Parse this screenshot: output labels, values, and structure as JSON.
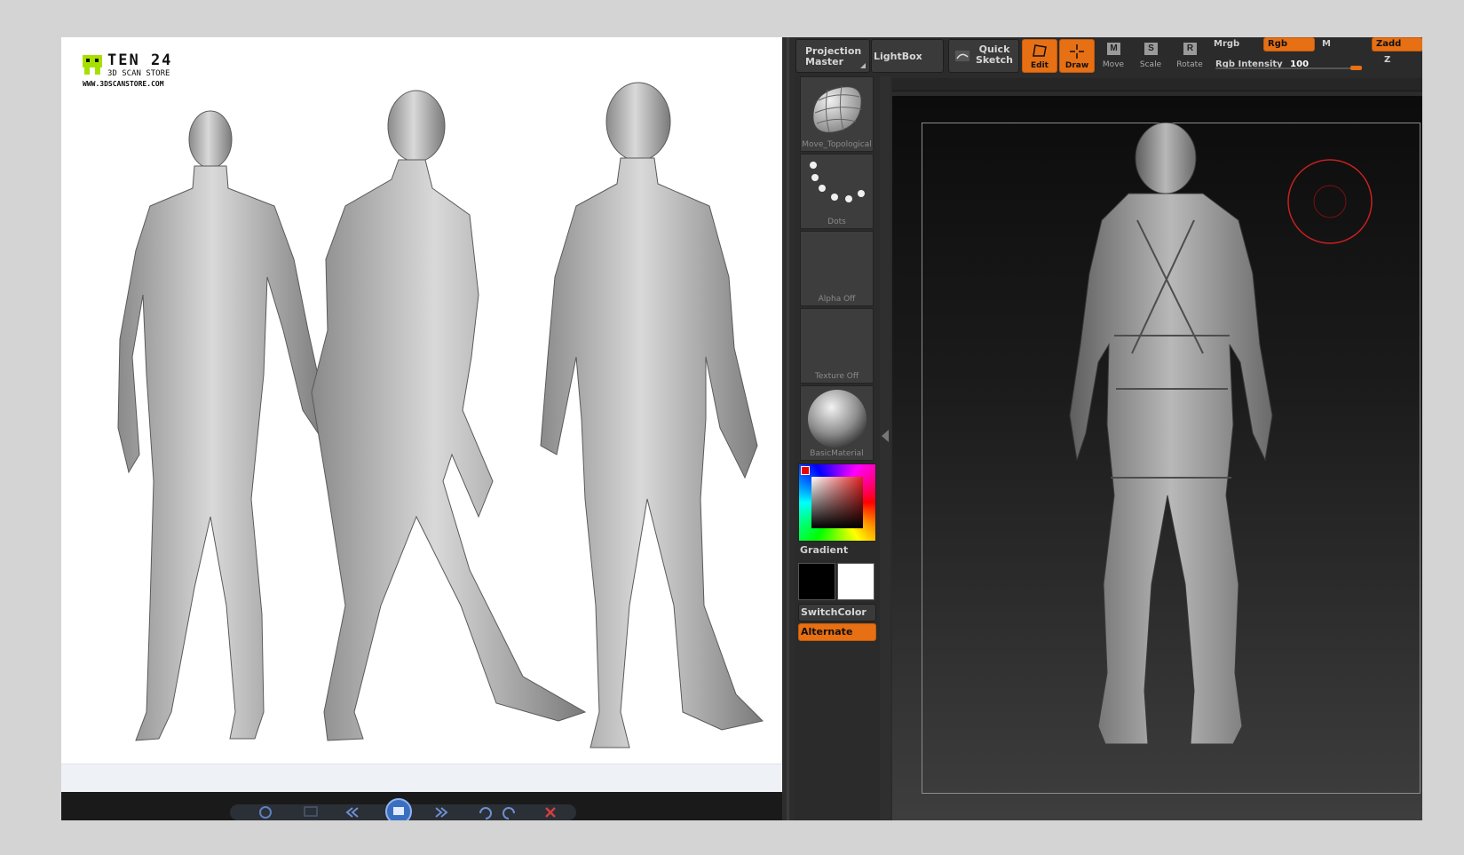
{
  "viewer": {
    "logo": {
      "brand": "TEN 24",
      "subtitle": "3D SCAN STORE",
      "url": "WWW.3DSCANSTORE.COM"
    }
  },
  "zbrush": {
    "toolbar": {
      "projection_master": "Projection Master",
      "lightbox": "LightBox",
      "quick_sketch": "Quick Sketch",
      "edit": "Edit",
      "draw": "Draw",
      "move": "Move",
      "scale": "Scale",
      "rotate": "Rotate",
      "move_key": "M",
      "scale_key": "S",
      "rotate_key": "R",
      "mrgb": "Mrgb",
      "rgb": "Rgb",
      "m": "M",
      "zadd": "Zadd",
      "z": "Z",
      "rgb_intensity_label": "Rgb Intensity",
      "rgb_intensity_value": "100"
    },
    "tray": {
      "brush": "Move_Topological",
      "stroke": "Dots",
      "alpha": "Alpha Off",
      "texture": "Texture Off",
      "material": "BasicMaterial",
      "gradient": "Gradient",
      "switch_color": "SwitchColor",
      "alternate": "Alternate"
    },
    "colors": {
      "accent": "#e76f14",
      "main_color": "#000000",
      "secondary_color": "#ffffff"
    }
  }
}
